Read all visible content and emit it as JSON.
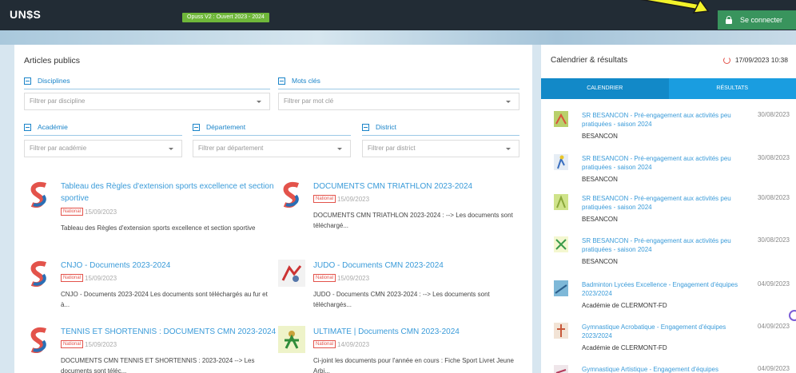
{
  "header": {
    "logo": "UN$S",
    "version_badge": "Opuss V2 : Ouvert 2023 - 2024",
    "connect_label": "Se connecter"
  },
  "articles": {
    "title": "Articles publics",
    "filters": {
      "disciplines_label": "Disciplines",
      "disciplines_placeholder": "Filtrer par discipline",
      "keywords_label": "Mots clés",
      "keywords_placeholder": "Filtrer par mot clé",
      "academie_label": "Académie",
      "academie_placeholder": "Filtrer par académie",
      "departement_label": "Département",
      "departement_placeholder": "Filtrer par département",
      "district_label": "District",
      "district_placeholder": "Filtrer par district"
    },
    "items": [
      {
        "title": "Tableau des Règles d'extension sports excellence et section sportive",
        "badge": "National",
        "date": "15/09/2023",
        "snippet": "Tableau des Règles d'extension sports excellence et section sportive"
      },
      {
        "title": "DOCUMENTS CMN TRIATHLON 2023-2024",
        "badge": "National",
        "date": "15/09/2023",
        "snippet": "DOCUMENTS CMN TRIATHLON 2023-2024 : --> Les documents sont téléchargé..."
      },
      {
        "title": "CNJO - Documents 2023-2024",
        "badge": "National",
        "date": "15/09/2023",
        "snippet": "CNJO - Documents 2023-2024 Les documents sont téléchargés au fur et à..."
      },
      {
        "title": "JUDO - Documents CMN 2023-2024",
        "badge": "National",
        "date": "15/09/2023",
        "snippet": "JUDO - Documents CMN 2023-2024 : --> Les documents sont téléchargés..."
      },
      {
        "title": "TENNIS ET SHORTENNIS : DOCUMENTS CMN 2023-2024",
        "badge": "National",
        "date": "15/09/2023",
        "snippet": "DOCUMENTS CMN TENNIS ET SHORTENNIS : 2023-2024 --> Les documents sont téléc..."
      },
      {
        "title": "ULTIMATE | Documents CMN 2023-2024",
        "badge": "National",
        "date": "14/09/2023",
        "snippet": "Ci-joint les documents pour l'année en cours : Fiche Sport Livret Jeune Arbi..."
      }
    ]
  },
  "calendar": {
    "title": "Calendrier & résultats",
    "datetime": "17/09/2023 10:38",
    "tab_calendar": "CALENDRIER",
    "tab_results": "RÉSULTATS",
    "events": [
      {
        "title": "SR BESANCON - Pré-engagement aux activités peu pratiquées - saison 2024",
        "sub": "BESANCON",
        "date": "30/08/2023"
      },
      {
        "title": "SR BESANCON - Pré-engagement aux activités peu pratiquées - saison 2024",
        "sub": "BESANCON",
        "date": "30/08/2023"
      },
      {
        "title": "SR BESANCON - Pré-engagement aux activités peu pratiquées - saison 2024",
        "sub": "BESANCON",
        "date": "30/08/2023"
      },
      {
        "title": "SR BESANCON - Pré-engagement aux activités peu pratiquées - saison 2024",
        "sub": "BESANCON",
        "date": "30/08/2023"
      },
      {
        "title": "Badminton Lycées Excellence - Engagement d'équipes 2023/2024",
        "sub": "Académie de CLERMONT-FD",
        "date": "04/09/2023"
      },
      {
        "title": "Gymnastique Acrobatique - Engagement d'équipes 2023/2024",
        "sub": "Académie de CLERMONT-FD",
        "date": "04/09/2023"
      },
      {
        "title": "Gymnastique Artistique - Engagement d'équipes",
        "sub": "",
        "date": "04/09/2023"
      }
    ]
  }
}
